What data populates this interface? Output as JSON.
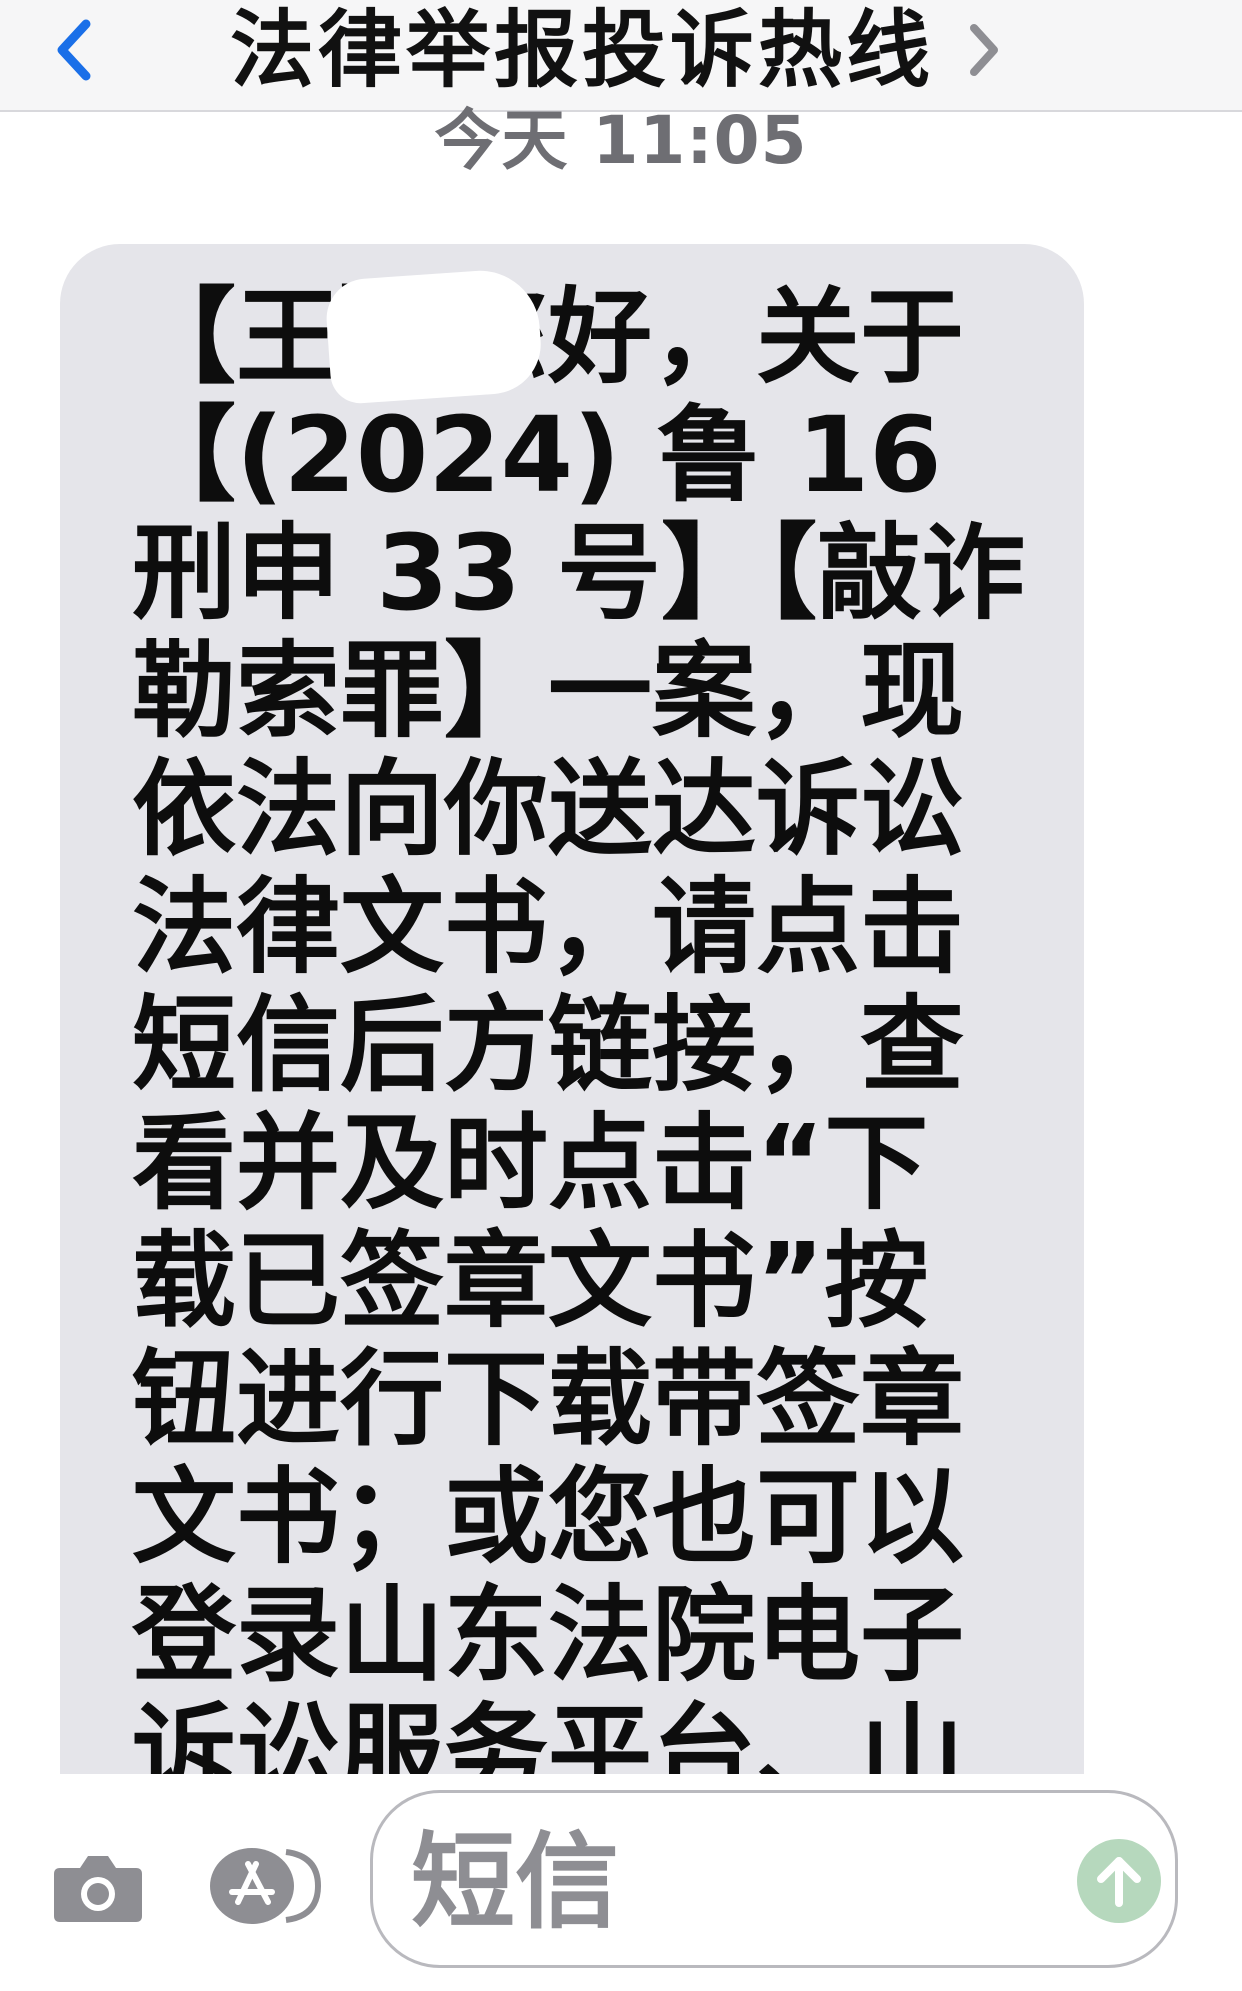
{
  "header": {
    "back_icon": "chevron-left-icon",
    "title": "法律举报投诉热线",
    "detail_icon": "chevron-right-icon"
  },
  "timestamp": "今天 11:05",
  "message": {
    "text": "【王】您好，关于【(2024) 鲁 16 刑申 33 号】【敲诈勒索罪】一案，现依法向你送达诉讼法律文书，请点击短信后方链接，查看并及时点击“下载已签章文书”按钮进行下载带签章文书；或您也可以登录山东法院电子诉讼服务平台、山东法院诉讼服务号，或"
  },
  "input_bar": {
    "camera_icon": "camera-icon",
    "appstore_icon": "app-store-icon",
    "placeholder": "短信",
    "send_icon": "send-arrow-up-icon"
  },
  "colors": {
    "bubble_bg": "#e5e5ea",
    "header_bg": "#f6f6f7",
    "accent_blue": "#1a6fe8",
    "timestamp_gray": "#6e6e73",
    "send_disabled": "#b6d8bd"
  }
}
